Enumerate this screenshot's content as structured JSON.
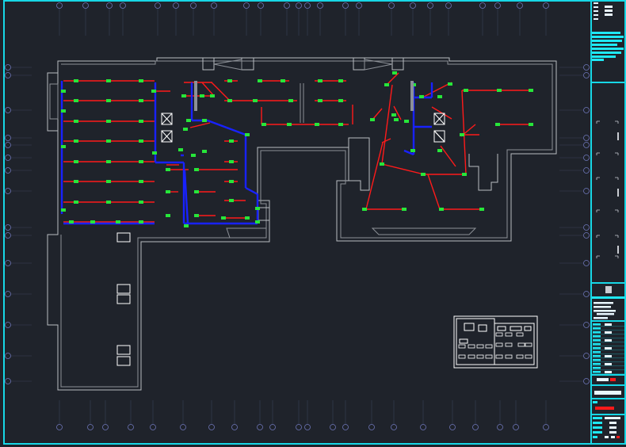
{
  "drawing": {
    "kind": "HVAC duct floor plan",
    "colors": {
      "background": "#1f232b",
      "frame": "#17d7e6",
      "supply_duct": "#ff1a1a",
      "main_duct": "#1822ff",
      "diffuser": "#27e63a",
      "wall": "#b9bcc2",
      "axis_bubble": "#6e76b8"
    }
  },
  "icons": [
    "axis-bubble-icon",
    "diffuser-icon",
    "fan-coil-unit-icon",
    "key-plan-icon",
    "north-arrow-icon"
  ]
}
